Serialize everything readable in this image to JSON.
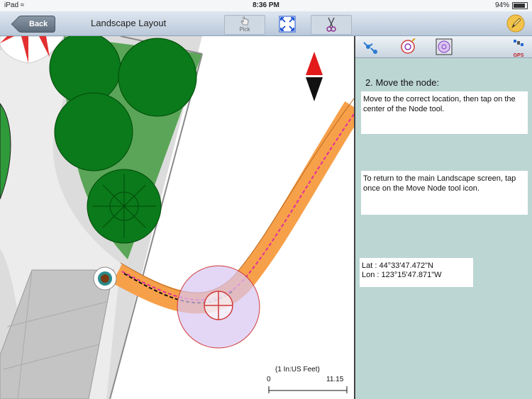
{
  "status_bar": {
    "device": "iPad",
    "time": "8:36 PM",
    "battery": "94%"
  },
  "nav": {
    "back_label": "Back",
    "title": "Landscape Layout",
    "pick_label": "Pick"
  },
  "panel": {
    "gps_label": "GPS",
    "step_title": "2. Move the node:",
    "instruction_1": "Move to the correct location, then tap on the center of the Node tool.",
    "instruction_2": "To return to the main Landscape screen, tap once on the Move Node tool icon.",
    "lat": "Lat : 44°33'47.472\"N",
    "lon": "Lon : 123°15'47.871\"W"
  },
  "scale": {
    "units": "(1 In:US Feet)",
    "start": "0",
    "end": "11.15"
  },
  "colors": {
    "path": "#f7a04a",
    "tree": "#0a7a1a",
    "lawn": "#5aa558",
    "panel_bg": "#bcd6d3",
    "node_circle": "#d8c6f2"
  }
}
